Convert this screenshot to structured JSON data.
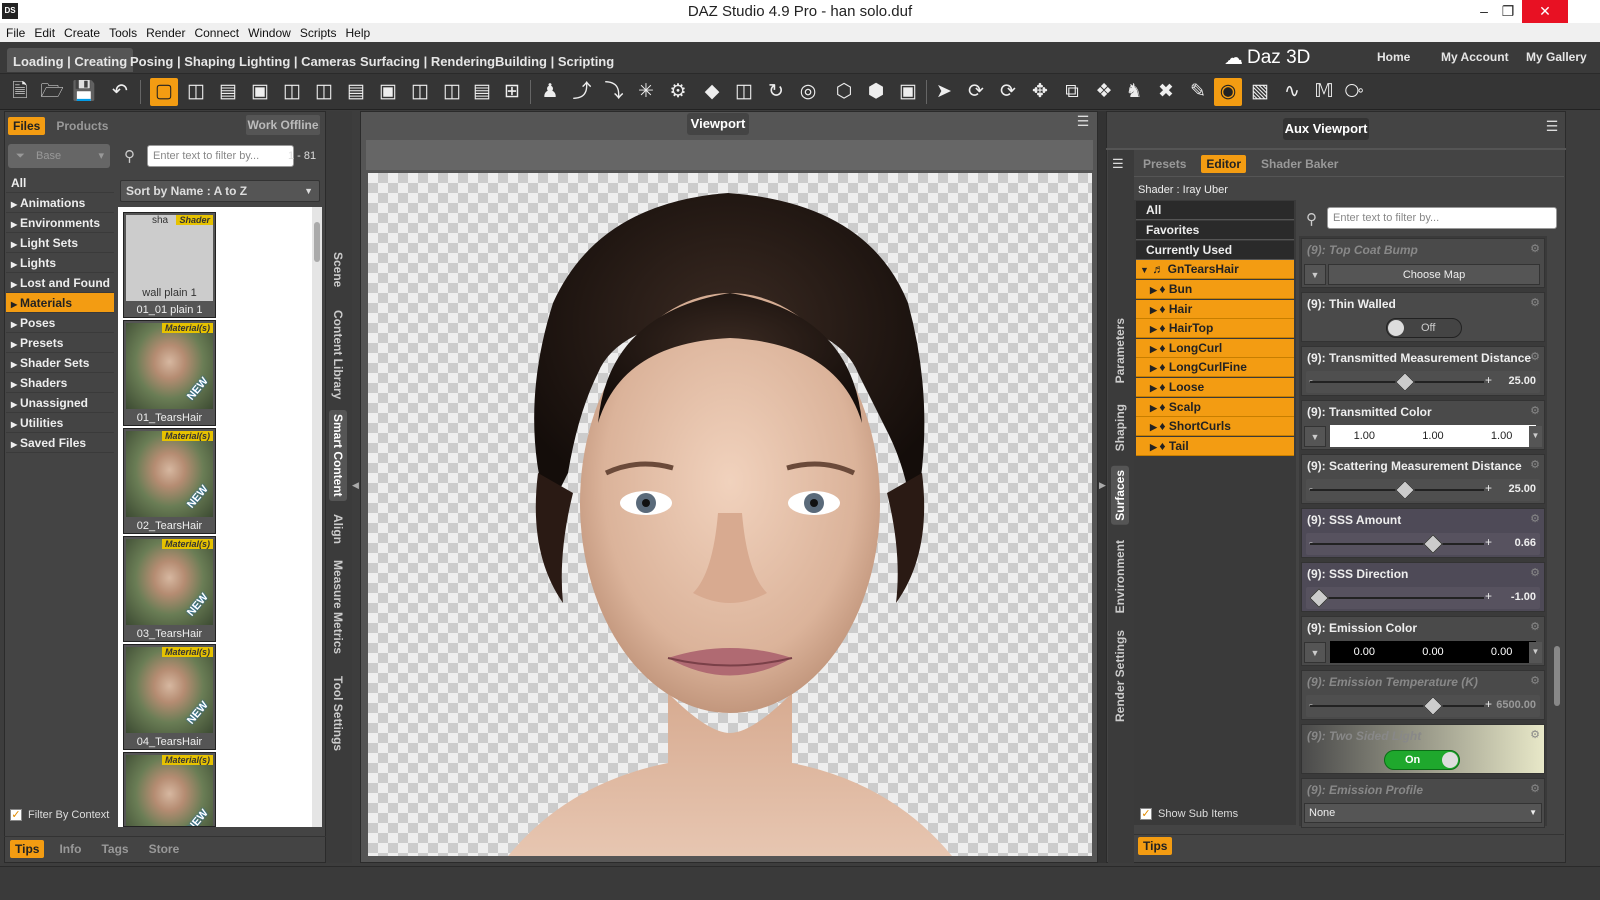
{
  "window": {
    "title": "DAZ Studio 4.9 Pro - han solo.duf",
    "icon_label": "DS"
  },
  "menu": [
    "File",
    "Edit",
    "Create",
    "Tools",
    "Render",
    "Connect",
    "Window",
    "Scripts",
    "Help"
  ],
  "layout_tabs": [
    {
      "label": "Loading | Creating",
      "active": true
    },
    {
      "label": "Posing | Shaping"
    },
    {
      "label": "Lighting | Cameras"
    },
    {
      "label": "Surfacing | Rendering"
    },
    {
      "label": "Building | Scripting"
    }
  ],
  "top_links": {
    "logo": "Daz 3D",
    "home": "Home",
    "account": "My Account",
    "gallery": "My Gallery"
  },
  "left": {
    "tabs": {
      "files": "Files",
      "products": "Products",
      "offline": "Work Offline"
    },
    "base": "Base",
    "filter_placeholder": "Enter text to filter by...",
    "count": "1 - 81",
    "sort": "Sort by Name : A to Z",
    "categories": [
      "All",
      "Animations",
      "Environments",
      "Light Sets",
      "Lights",
      "Lost and Found",
      "Materials",
      "Poses",
      "Presets",
      "Shader Sets",
      "Shaders",
      "Unassigned",
      "Utilities",
      "Saved Files"
    ],
    "thumbs": [
      {
        "badge": "Shader",
        "inner": "wall plain 1",
        "caption": "01_01 plain 1",
        "inner_top": "sha"
      },
      {
        "badge": "Material(s)",
        "caption": "01_TearsHair",
        "new": "NEW"
      },
      {
        "badge": "Material(s)",
        "caption": "02_TearsHair",
        "new": "NEW"
      },
      {
        "badge": "Material(s)",
        "caption": "03_TearsHair",
        "new": "NEW"
      },
      {
        "badge": "Material(s)",
        "caption": "04_TearsHair",
        "new": "NEW"
      },
      {
        "badge": "Material(s)",
        "caption": "",
        "new": "NEW"
      }
    ],
    "filter_context": "Filter By Context",
    "bottom_tabs": [
      "Tips",
      "Info",
      "Tags",
      "Store"
    ]
  },
  "side_tabs_left": [
    "Scene",
    "Content Library",
    "Smart Content",
    "Align",
    "Measure Metrics",
    "Tool Settings"
  ],
  "viewport": {
    "title": "Viewport"
  },
  "aux": {
    "title": "Aux Viewport"
  },
  "side_tabs_right": [
    "Parameters",
    "Shaping",
    "Surfaces",
    "Environment",
    "Render Settings"
  ],
  "surfaces": {
    "tabs": [
      "Presets",
      "Editor",
      "Shader Baker"
    ],
    "shader": "Shader : Iray Uber",
    "filter_placeholder": "Enter text to filter by...",
    "scats": [
      "All",
      "Favorites",
      "Currently Used"
    ],
    "root": "GnTearsHair",
    "materials": [
      "Bun",
      "Hair",
      "HairTop",
      "LongCurl",
      "LongCurlFine",
      "Loose",
      "Scalp",
      "ShortCurls",
      "Tail"
    ],
    "show_sub": "Show Sub Items",
    "props": [
      {
        "title": "(9): Top Coat Bump",
        "button": "Choose Map"
      },
      {
        "title": "(9): Thin Walled",
        "toggle": "Off"
      },
      {
        "title": "(9): Transmitted Measurement Distance",
        "value": "25.00"
      },
      {
        "title": "(9): Transmitted Color",
        "c1": "1.00",
        "c2": "1.00",
        "c3": "1.00"
      },
      {
        "title": "(9): Scattering Measurement Distance",
        "value": "25.00"
      },
      {
        "title": "(9): SSS Amount",
        "value": "0.66"
      },
      {
        "title": "(9): SSS Direction",
        "value": "-1.00"
      },
      {
        "title": "(9): Emission Color",
        "c1": "0.00",
        "c2": "0.00",
        "c3": "0.00"
      },
      {
        "title": "(9): Emission Temperature (K)",
        "value": "6500.00"
      },
      {
        "title": "(9): Two Sided Light",
        "toggle": "On"
      },
      {
        "title": "(9): Emission Profile",
        "select": "None"
      }
    ],
    "bottom_tab": "Tips"
  },
  "colors": {
    "accent": "#f39c12",
    "panel": "#444444",
    "close": "#e81123"
  }
}
